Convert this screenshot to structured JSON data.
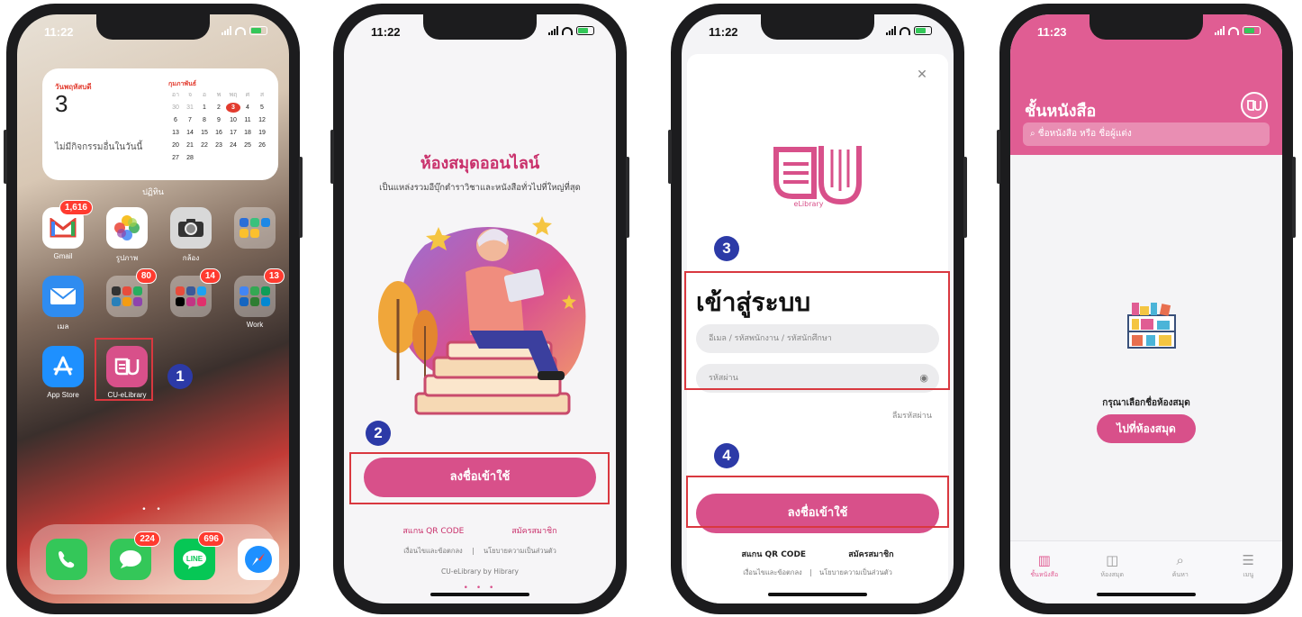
{
  "colors": {
    "accent": "#d8508a",
    "brand_pink": "#e05d93",
    "marker": "#2c3aa7",
    "highlight": "#d9383f"
  },
  "markers": [
    "1",
    "2",
    "3",
    "4"
  ],
  "phone1": {
    "time": "11:22",
    "widget": {
      "weekday": "วันพฤหัสบดี",
      "day_number": "3",
      "no_events": "ไม่มีกิจกรรมอื่นในวันนี้",
      "month": "กุมภาพันธ์",
      "week_header": [
        "อา",
        "จ",
        "อ",
        "พ",
        "พฤ",
        "ศ",
        "ส"
      ],
      "days": [
        "30",
        "31",
        "1",
        "2",
        "3",
        "4",
        "5",
        "6",
        "7",
        "8",
        "9",
        "10",
        "11",
        "12",
        "13",
        "14",
        "15",
        "16",
        "17",
        "18",
        "19",
        "20",
        "21",
        "22",
        "23",
        "24",
        "25",
        "26",
        "27",
        "28"
      ]
    },
    "widget_caption": "ปฏิทิน",
    "apps": [
      {
        "label": "Gmail",
        "badge": "1,616",
        "icon": "gmail-icon"
      },
      {
        "label": "รูปภาพ",
        "badge": "",
        "icon": "photos-icon"
      },
      {
        "label": "กล้อง",
        "badge": "",
        "icon": "camera-icon"
      },
      {
        "label": "",
        "badge": "",
        "icon": "folder-icon"
      },
      {
        "label": "เมล",
        "badge": "",
        "icon": "mail-icon"
      },
      {
        "label": "",
        "badge": "80",
        "icon": "folder-icon"
      },
      {
        "label": "",
        "badge": "14",
        "icon": "folder-icon"
      },
      {
        "label": "Work",
        "badge": "13",
        "icon": "folder-icon"
      },
      {
        "label": "App Store",
        "badge": "",
        "icon": "app-store-icon"
      },
      {
        "label": "CU-eLibrary",
        "badge": "",
        "icon": "cu-elibrary-icon"
      }
    ],
    "dock": [
      {
        "icon": "phone-icon",
        "badge": ""
      },
      {
        "icon": "messages-icon",
        "badge": "224"
      },
      {
        "icon": "line-icon",
        "badge": "696"
      },
      {
        "icon": "safari-icon",
        "badge": ""
      }
    ]
  },
  "phone2": {
    "time": "11:22",
    "title": "ห้องสมุดออนไลน์",
    "subtitle": "เป็นแหล่งรวมอีบุ๊กตำราวิชาและหนังสือทั่วไปที่ใหญ่ที่สุด",
    "login_button": "ลงชื่อเข้าใช้",
    "scan_qr": "สแกน QR CODE",
    "register": "สมัครสมาชิก",
    "terms": "เงื่อนไขและข้อตกลง",
    "privacy": "นโยบายความเป็นส่วนตัว",
    "separator": "|",
    "footer": "CU-eLibrary by Hibrary"
  },
  "phone3": {
    "time": "11:22",
    "logo_text": "eLibrary",
    "title": "เข้าสู่ระบบ",
    "username_placeholder": "อีเมล / รหัสพนักงาน / รหัสนักศึกษา",
    "password_placeholder": "รหัสผ่าน",
    "forgot": "ลืมรหัสผ่าน",
    "login_button": "ลงชื่อเข้าใช้",
    "scan_qr": "สแกน QR CODE",
    "register": "สมัครสมาชิก",
    "terms": "เงื่อนไขและข้อตกลง",
    "privacy": "นโยบายความเป็นส่วนตัว",
    "separator": "|"
  },
  "phone4": {
    "time": "11:23",
    "title": "ชั้นหนังสือ",
    "search_placeholder": "ชื่อหนังสือ หรือ ชื่อผู้แต่ง",
    "empty_message": "กรุณาเลือกชื่อห้องสมุด",
    "go_library_button": "ไปที่ห้องสมุด",
    "tabs": [
      {
        "label": "ชั้นหนังสือ",
        "icon": "bookshelf-icon"
      },
      {
        "label": "ห้องสมุด",
        "icon": "library-icon"
      },
      {
        "label": "ค้นหา",
        "icon": "search-icon"
      },
      {
        "label": "เมนู",
        "icon": "menu-icon"
      }
    ]
  }
}
